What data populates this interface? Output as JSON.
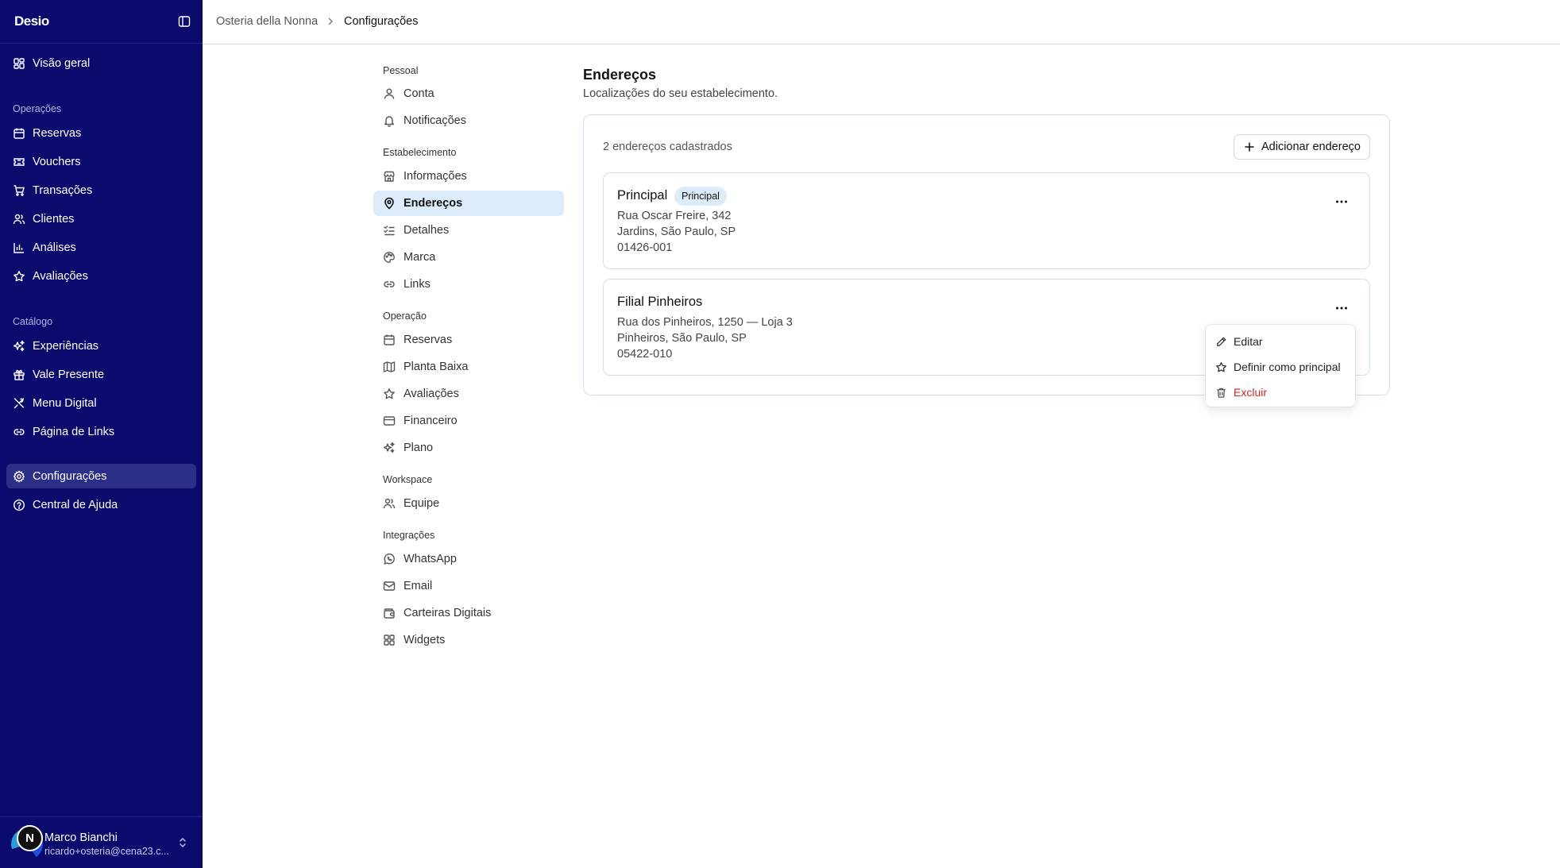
{
  "sidebar": {
    "logo": "Desio",
    "items_top": [
      {
        "label": "Visão geral",
        "icon": "dashboard-icon"
      }
    ],
    "sections": [
      {
        "title": "Operações",
        "items": [
          {
            "label": "Reservas",
            "icon": "calendar-icon"
          },
          {
            "label": "Vouchers",
            "icon": "ticket-icon"
          },
          {
            "label": "Transações",
            "icon": "cart-icon"
          },
          {
            "label": "Clientes",
            "icon": "users-icon"
          },
          {
            "label": "Análises",
            "icon": "bar-chart-icon"
          },
          {
            "label": "Avaliações",
            "icon": "star-icon"
          }
        ]
      },
      {
        "title": "Catálogo",
        "items": [
          {
            "label": "Experiências",
            "icon": "sparkles-icon"
          },
          {
            "label": "Vale Presente",
            "icon": "gift-icon"
          },
          {
            "label": "Menu Digital",
            "icon": "utensils-icon"
          },
          {
            "label": "Página de Links",
            "icon": "link-icon"
          }
        ]
      }
    ],
    "items_bottom": [
      {
        "label": "Configurações",
        "icon": "gear-icon",
        "active": true
      },
      {
        "label": "Central de Ajuda",
        "icon": "help-circle-icon"
      }
    ],
    "user": {
      "initial": "N",
      "name": "Marco Bianchi",
      "email": "ricardo+osteria@cena23.c..."
    }
  },
  "breadcrumb": {
    "items": [
      "Osteria della Nonna",
      "Configurações"
    ]
  },
  "settings_nav": {
    "groups": [
      {
        "title": "Pessoal",
        "items": [
          {
            "label": "Conta",
            "icon": "user-icon"
          },
          {
            "label": "Notificações",
            "icon": "bell-icon"
          }
        ]
      },
      {
        "title": "Estabelecimento",
        "items": [
          {
            "label": "Informações",
            "icon": "store-icon"
          },
          {
            "label": "Endereços",
            "icon": "map-pin-icon",
            "active": true
          },
          {
            "label": "Detalhes",
            "icon": "list-checks-icon"
          },
          {
            "label": "Marca",
            "icon": "palette-icon"
          },
          {
            "label": "Links",
            "icon": "link-icon"
          }
        ]
      },
      {
        "title": "Operação",
        "items": [
          {
            "label": "Reservas",
            "icon": "calendar-icon"
          },
          {
            "label": "Planta Baixa",
            "icon": "map-icon"
          },
          {
            "label": "Avaliações",
            "icon": "star-icon"
          },
          {
            "label": "Financeiro",
            "icon": "credit-card-icon"
          },
          {
            "label": "Plano",
            "icon": "sparkles-icon"
          }
        ]
      },
      {
        "title": "Workspace",
        "items": [
          {
            "label": "Equipe",
            "icon": "users-icon"
          }
        ]
      },
      {
        "title": "Integrações",
        "items": [
          {
            "label": "WhatsApp",
            "icon": "whatsapp-icon"
          },
          {
            "label": "Email",
            "icon": "mail-icon"
          },
          {
            "label": "Carteiras Digitais",
            "icon": "wallet-icon"
          },
          {
            "label": "Widgets",
            "icon": "grid-icon"
          }
        ]
      }
    ]
  },
  "main": {
    "title": "Endereços",
    "subtitle": "Localizações do seu estabelecimento.",
    "count_text": "2 endereços cadastrados",
    "add_button": "Adicionar endereço",
    "addresses": [
      {
        "name": "Principal",
        "badge": "Principal",
        "street": "Rua Oscar Freire, 342",
        "city": "Jardins, São Paulo, SP",
        "zip": "01426-001"
      },
      {
        "name": "Filial Pinheiros",
        "badge": "",
        "street": "Rua dos Pinheiros, 1250 — Loja 3",
        "city": "Pinheiros, São Paulo, SP",
        "zip": "05422-010"
      }
    ],
    "more_icon": "ellipsis-icon",
    "menu": {
      "items": [
        {
          "label": "Editar",
          "icon": "pencil-icon"
        },
        {
          "label": "Definir como principal",
          "icon": "star-icon"
        },
        {
          "label": "Excluir",
          "icon": "trash-icon",
          "danger": true
        }
      ]
    }
  },
  "colors": {
    "sidebar_bg": "#0b0b6e",
    "active_nav_bg": "#dcecfa",
    "danger": "#d42222",
    "border": "#cfe0ea"
  }
}
